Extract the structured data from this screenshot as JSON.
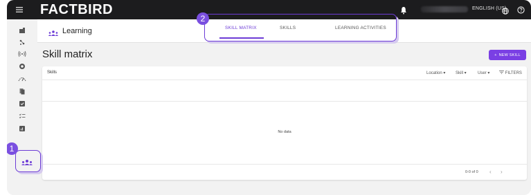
{
  "topbar": {
    "logo": "FACTBIRD",
    "language": "ENGLISH (US)",
    "icons": [
      "menu-icon",
      "bell-icon",
      "globe-icon",
      "help-icon"
    ]
  },
  "sidebar": {
    "icons": [
      "dashboard-icon",
      "lines-icon",
      "signal-icon",
      "target-icon",
      "stops-icon",
      "documents-icon",
      "checklist-icon",
      "tasks-icon",
      "reports-icon",
      "learning-icon"
    ]
  },
  "header": {
    "title": "Learning",
    "tabs": [
      {
        "label": "SKILL MATRIX",
        "active": true
      },
      {
        "label": "SKILLS",
        "active": false
      },
      {
        "label": "LEARNING ACTIVITIES",
        "active": false
      }
    ]
  },
  "callouts": {
    "one": "1",
    "two": "2"
  },
  "main": {
    "page_title": "Skill matrix",
    "new_button": "NEW SKILL",
    "new_button_plus": "+",
    "table": {
      "label": "Skills",
      "filters": {
        "location": "Location",
        "skill": "Skill",
        "user": "User",
        "filters_btn": "FILTERS"
      },
      "empty_text": "No data",
      "pagination": "0-0 of 0"
    }
  },
  "colors": {
    "accent": "#7a3fe4",
    "topbar": "#1c1c1e",
    "background": "#f2f2f2"
  }
}
